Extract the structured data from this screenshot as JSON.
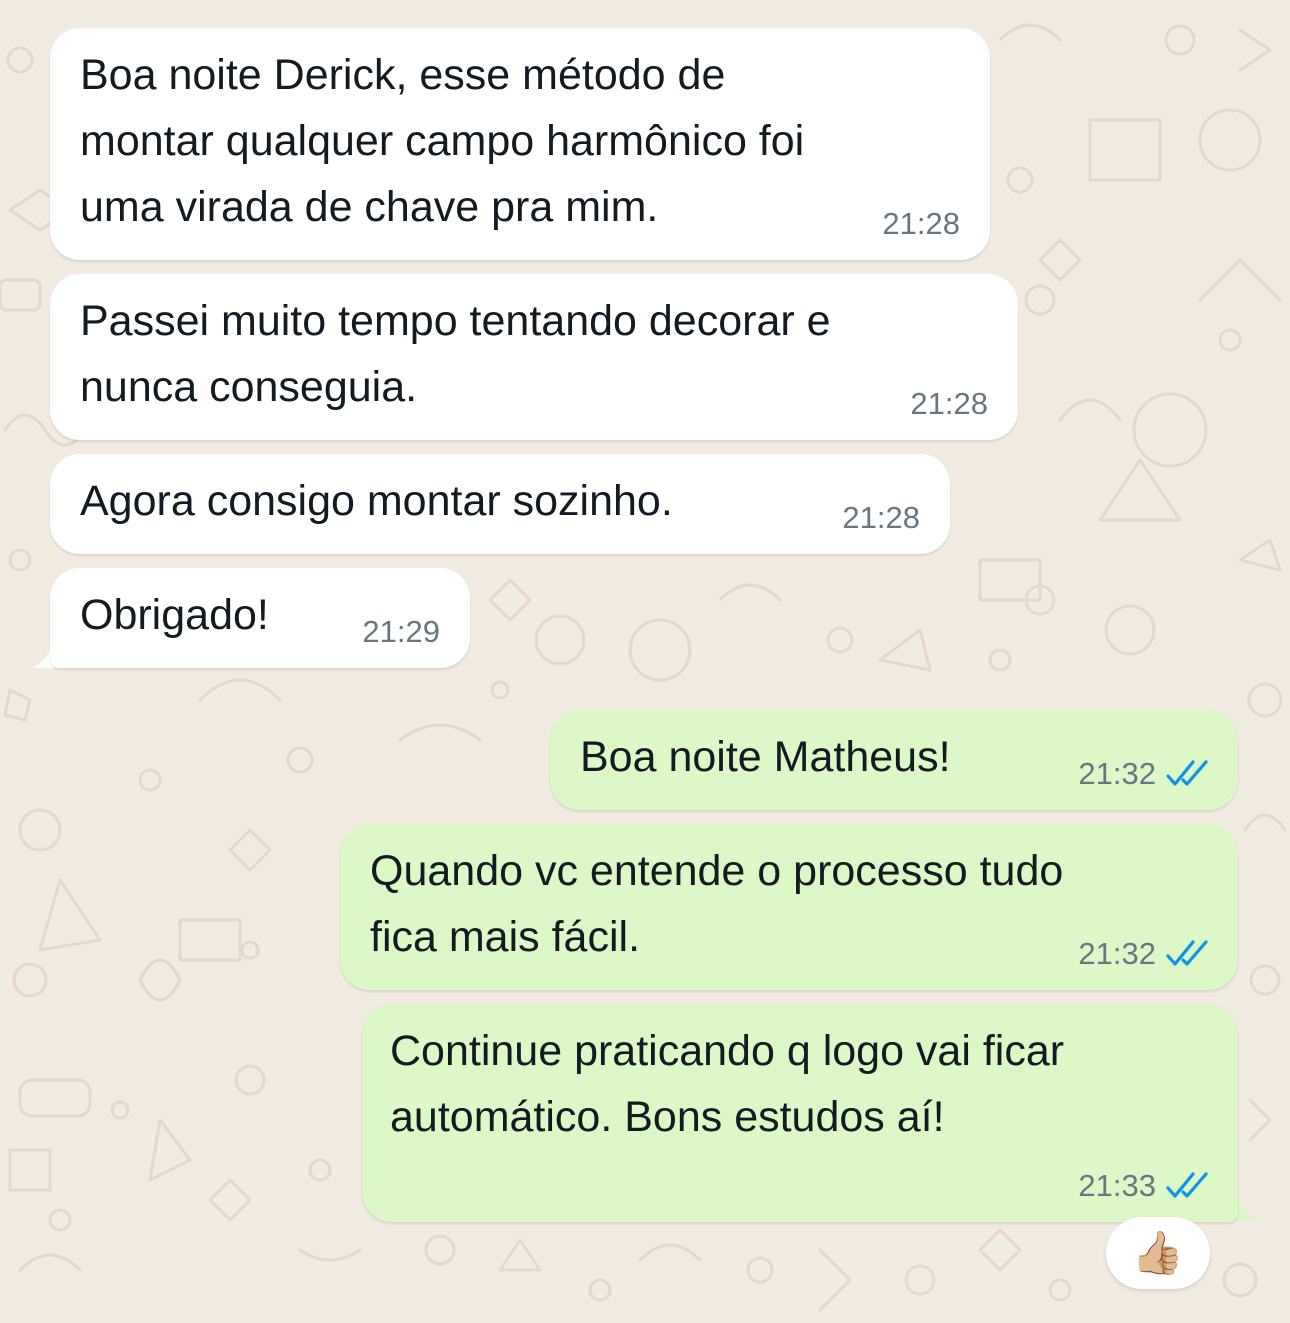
{
  "chat": {
    "messages": [
      {
        "direction": "incoming",
        "lines": [
          "Boa noite Derick, esse método de",
          "montar qualquer campo harmônico foi",
          "uma virada de chave pra mim."
        ],
        "time": "21:28"
      },
      {
        "direction": "incoming",
        "lines": [
          "Passei muito tempo tentando decorar e",
          "nunca conseguia."
        ],
        "time": "21:28"
      },
      {
        "direction": "incoming",
        "lines": [
          "Agora consigo montar sozinho."
        ],
        "time": "21:28"
      },
      {
        "direction": "incoming",
        "lines": [
          "Obrigado!"
        ],
        "time": "21:29"
      },
      {
        "direction": "outgoing",
        "lines": [
          "Boa noite Matheus!"
        ],
        "time": "21:32",
        "status_icon": "double-check-read-icon"
      },
      {
        "direction": "outgoing",
        "lines": [
          "Quando vc entende o processo tudo",
          "fica mais fácil."
        ],
        "time": "21:32",
        "status_icon": "double-check-read-icon"
      },
      {
        "direction": "outgoing",
        "lines": [
          "Continue praticando q logo vai ficar",
          "automático. Bons estudos aí!"
        ],
        "time": "21:33",
        "status_icon": "double-check-read-icon",
        "reaction": "👍🏼"
      }
    ]
  },
  "colors": {
    "wallpaper": "#f2ebe2",
    "incoming_bubble": "#ffffff",
    "outgoing_bubble": "#dcf8c6",
    "text": "#111b21",
    "meta": "#667781",
    "read_ticks": "#0c93e8"
  }
}
